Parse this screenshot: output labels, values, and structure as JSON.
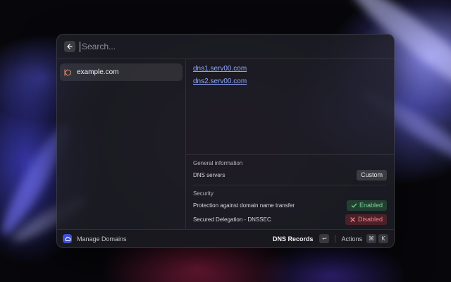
{
  "search": {
    "placeholder": "Search..."
  },
  "list": {
    "items": [
      {
        "label": "example.com"
      }
    ]
  },
  "detail": {
    "nameservers": [
      "dns1.serv00.com",
      "dns2.serv00.com"
    ],
    "general": {
      "heading": "General information",
      "dns_servers_label": "DNS servers",
      "dns_servers_value": "Custom"
    },
    "security": {
      "heading": "Security",
      "transfer_label": "Protection against domain name transfer",
      "transfer_value": "Enabled",
      "dnssec_label": "Secured Delegation - DNSSEC",
      "dnssec_value": "Disabled"
    }
  },
  "footer": {
    "title": "Manage Domains",
    "primary_action": "DNS Records",
    "primary_key": "↩",
    "secondary_action": "Actions",
    "secondary_keys": [
      "⌘",
      "K"
    ]
  },
  "icons": {
    "back": "arrow-left-icon",
    "app": "cloud-icon",
    "favicon": "site-favicon-icon",
    "check": "check-icon",
    "cross": "x-icon"
  },
  "colors": {
    "accent_link": "#8ea6ff",
    "enabled": "#7ed49a",
    "disabled": "#ff7c84",
    "app_icon": "#3c50d8"
  }
}
